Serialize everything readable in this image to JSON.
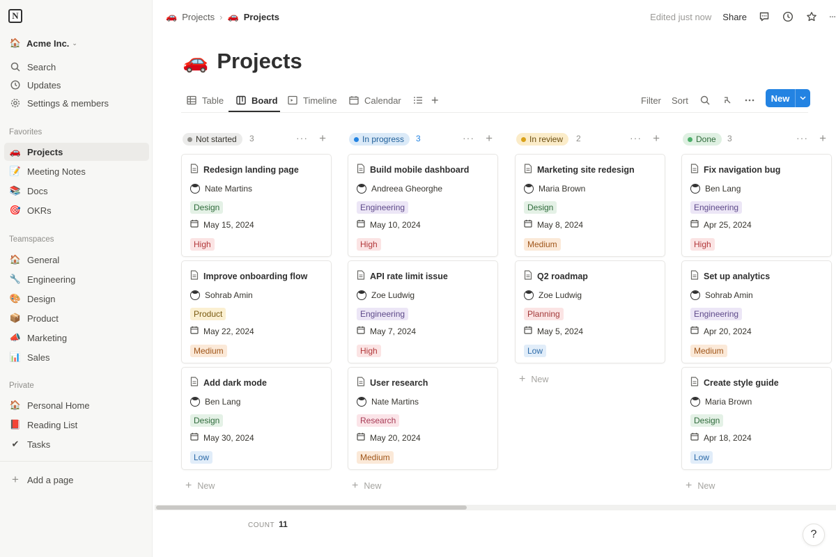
{
  "sidebar": {
    "logo_letter": "N",
    "workspace": "Acme Inc.",
    "workspace_chevron": "⌄",
    "top_items": [
      {
        "label": "Search",
        "icon": "search-icon"
      },
      {
        "label": "Updates",
        "icon": "clock-icon"
      },
      {
        "label": "Settings & members",
        "icon": "gear-icon"
      }
    ],
    "favorites_title": "Favorites",
    "favorites": [
      {
        "label": "Projects",
        "emoji": "🚗"
      },
      {
        "label": "Meeting Notes",
        "emoji": "📝"
      },
      {
        "label": "Docs",
        "emoji": "📚"
      },
      {
        "label": "OKRs",
        "emoji": "🎯"
      }
    ],
    "teamspaces_title": "Teamspaces",
    "teamspaces": [
      {
        "label": "General",
        "emoji": "🏠"
      },
      {
        "label": "Engineering",
        "emoji": "🔧"
      },
      {
        "label": "Design",
        "emoji": "🎨"
      },
      {
        "label": "Product",
        "emoji": "📦"
      },
      {
        "label": "Marketing",
        "emoji": "📣"
      },
      {
        "label": "Sales",
        "emoji": "📊"
      }
    ],
    "private_title": "Private",
    "private": [
      {
        "label": "Personal Home",
        "emoji": "🏠"
      },
      {
        "label": "Reading List",
        "emoji": "📕"
      },
      {
        "label": "Tasks",
        "emoji": "✔"
      }
    ],
    "add_page": "Add a page"
  },
  "topbar": {
    "breadcrumb": [
      "Projects",
      "Projects"
    ],
    "breadcrumb_emoji": "🚗",
    "edited": "Edited just now",
    "share": "Share"
  },
  "page": {
    "emoji": "🚗",
    "title": "Projects"
  },
  "views": {
    "tabs": [
      "Table",
      "Board",
      "Timeline",
      "Calendar"
    ],
    "active_tab": "Board",
    "filter": "Filter",
    "sort": "Sort",
    "new_button": "New"
  },
  "board": {
    "columns": [
      {
        "status": "Not started",
        "count": "3",
        "pill_bg": "#ebebea",
        "pill_color": "#37352f",
        "dot": "#8f8e8a",
        "count_color": "#8f8e8a",
        "new_label": "New",
        "cards": [
          {
            "title": "Redesign landing page",
            "assignee": "Nate Martins",
            "team": "Design",
            "date": "May 15, 2024",
            "priority": "High"
          },
          {
            "title": "Improve onboarding flow",
            "assignee": "Sohrab Amin",
            "team": "Product",
            "date": "May 22, 2024",
            "priority": "Medium"
          },
          {
            "title": "Add dark mode",
            "assignee": "Ben Lang",
            "team": "Design",
            "date": "May 30, 2024",
            "priority": "Low"
          }
        ]
      },
      {
        "status": "In progress",
        "count": "3",
        "pill_bg": "#dbeaf8",
        "pill_color": "#1f5f99",
        "dot": "#2383e2",
        "count_color": "#2383e2",
        "new_label": "New",
        "cards": [
          {
            "title": "Build mobile dashboard",
            "assignee": "Andreea Gheorghe",
            "team": "Engineering",
            "date": "May 10, 2024",
            "priority": "High"
          },
          {
            "title": "API rate limit issue",
            "assignee": "Zoe Ludwig",
            "team": "Engineering",
            "date": "May 7, 2024",
            "priority": "High"
          },
          {
            "title": "User research",
            "assignee": "Nate Martins",
            "team": "Research",
            "date": "May 20, 2024",
            "priority": "Medium"
          }
        ]
      },
      {
        "status": "In review",
        "count": "2",
        "pill_bg": "#fbecc9",
        "pill_color": "#6b4e10",
        "dot": "#d9a21b",
        "count_color": "#8f8e8a",
        "new_label": "New",
        "cards": [
          {
            "title": "Marketing site redesign",
            "assignee": "Maria Brown",
            "team": "Design",
            "date": "May 8, 2024",
            "priority": "Medium"
          },
          {
            "title": "Q2 roadmap",
            "assignee": "Zoe Ludwig",
            "team": "Planning",
            "date": "May 5, 2024",
            "priority": "Low"
          }
        ]
      },
      {
        "status": "Done",
        "count": "3",
        "pill_bg": "#dff0e2",
        "pill_color": "#2f6b3b",
        "dot": "#4caf6a",
        "count_color": "#8f8e8a",
        "new_label": "New",
        "cards": [
          {
            "title": "Fix navigation bug",
            "assignee": "Ben Lang",
            "team": "Engineering",
            "date": "Apr 25, 2024",
            "priority": "High"
          },
          {
            "title": "Set up analytics",
            "assignee": "Sohrab Amin",
            "team": "Engineering",
            "date": "Apr 20, 2024",
            "priority": "Medium"
          },
          {
            "title": "Create style guide",
            "assignee": "Maria Brown",
            "team": "Design",
            "date": "Apr 18, 2024",
            "priority": "Low"
          }
        ]
      }
    ]
  },
  "footer": {
    "count_label": "COUNT",
    "count_value": "11",
    "help": "?"
  }
}
